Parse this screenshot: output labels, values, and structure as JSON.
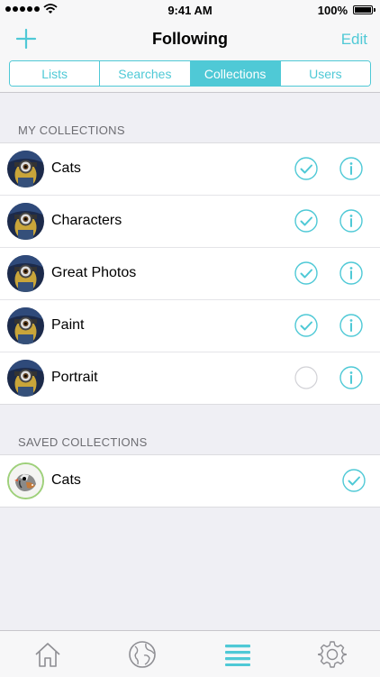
{
  "status_bar": {
    "time": "9:41 AM",
    "battery": "100%"
  },
  "nav": {
    "title": "Following",
    "edit_label": "Edit",
    "add_icon": "plus-icon"
  },
  "segments": [
    {
      "label": "Lists",
      "active": false
    },
    {
      "label": "Searches",
      "active": false
    },
    {
      "label": "Collections",
      "active": true
    },
    {
      "label": "Users",
      "active": false
    }
  ],
  "my_collections": {
    "header": "MY COLLECTIONS",
    "items": [
      {
        "name": "Cats",
        "checked": true
      },
      {
        "name": "Characters",
        "checked": true
      },
      {
        "name": "Great Photos",
        "checked": true
      },
      {
        "name": "Paint",
        "checked": true
      },
      {
        "name": "Portrait",
        "checked": false
      }
    ]
  },
  "saved_collections": {
    "header": "SAVED COLLECTIONS",
    "items": [
      {
        "name": "Cats",
        "checked": true
      }
    ]
  },
  "tab_bar": {
    "tabs": [
      "home-icon",
      "globe-icon",
      "menu-icon",
      "settings-icon"
    ],
    "active": "menu-icon"
  },
  "colors": {
    "accent": "#4fc9d6",
    "background": "#efeff4",
    "inactive_tab": "#8e8e93"
  }
}
